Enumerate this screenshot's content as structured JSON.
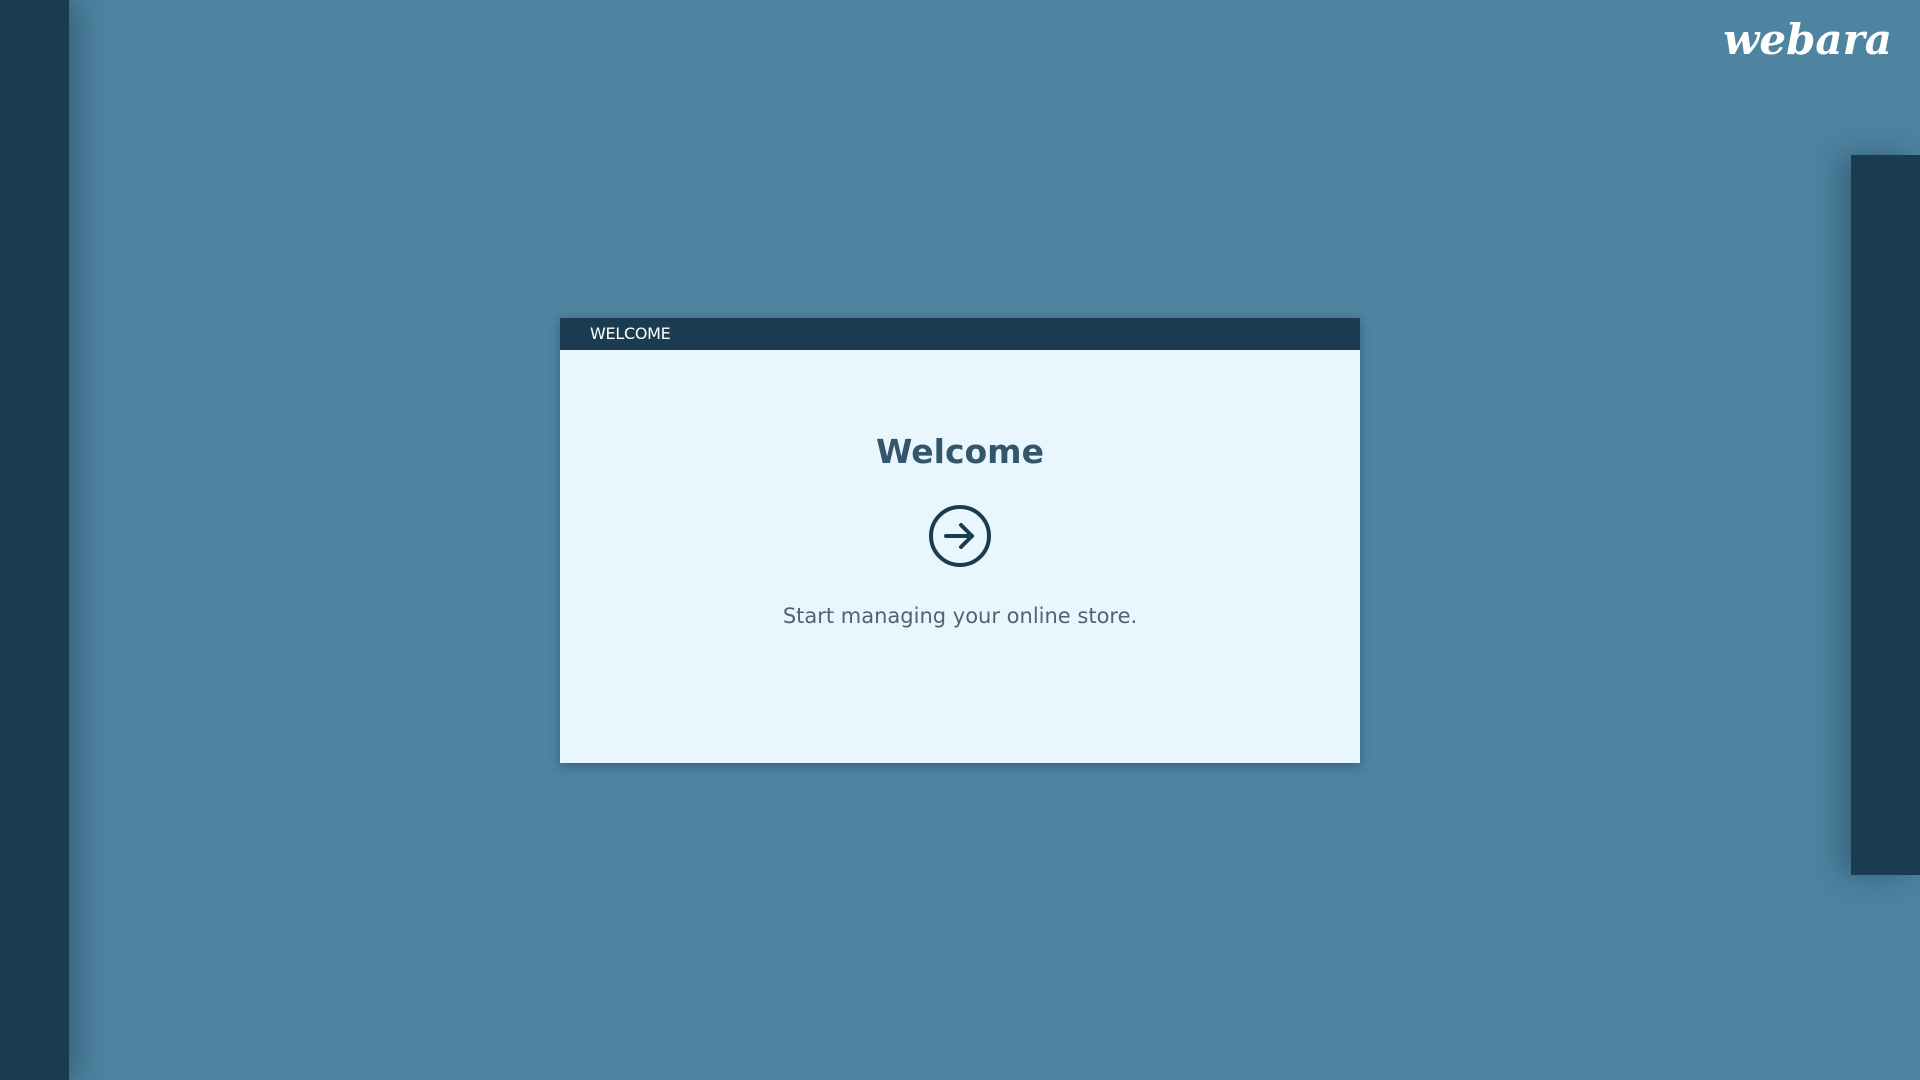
{
  "brand": {
    "logo_text": "webara"
  },
  "dialog": {
    "title": "WELCOME",
    "heading": "Welcome",
    "subtitle": "Start managing your online store.",
    "action_icon": "arrow-right-circle-icon"
  },
  "colors": {
    "background": "#4e84a0",
    "dark_navy": "#1b3b51",
    "dialog_background": "#e9f6fe",
    "heading_text": "#33566a",
    "subtitle_text": "#4f6470"
  }
}
